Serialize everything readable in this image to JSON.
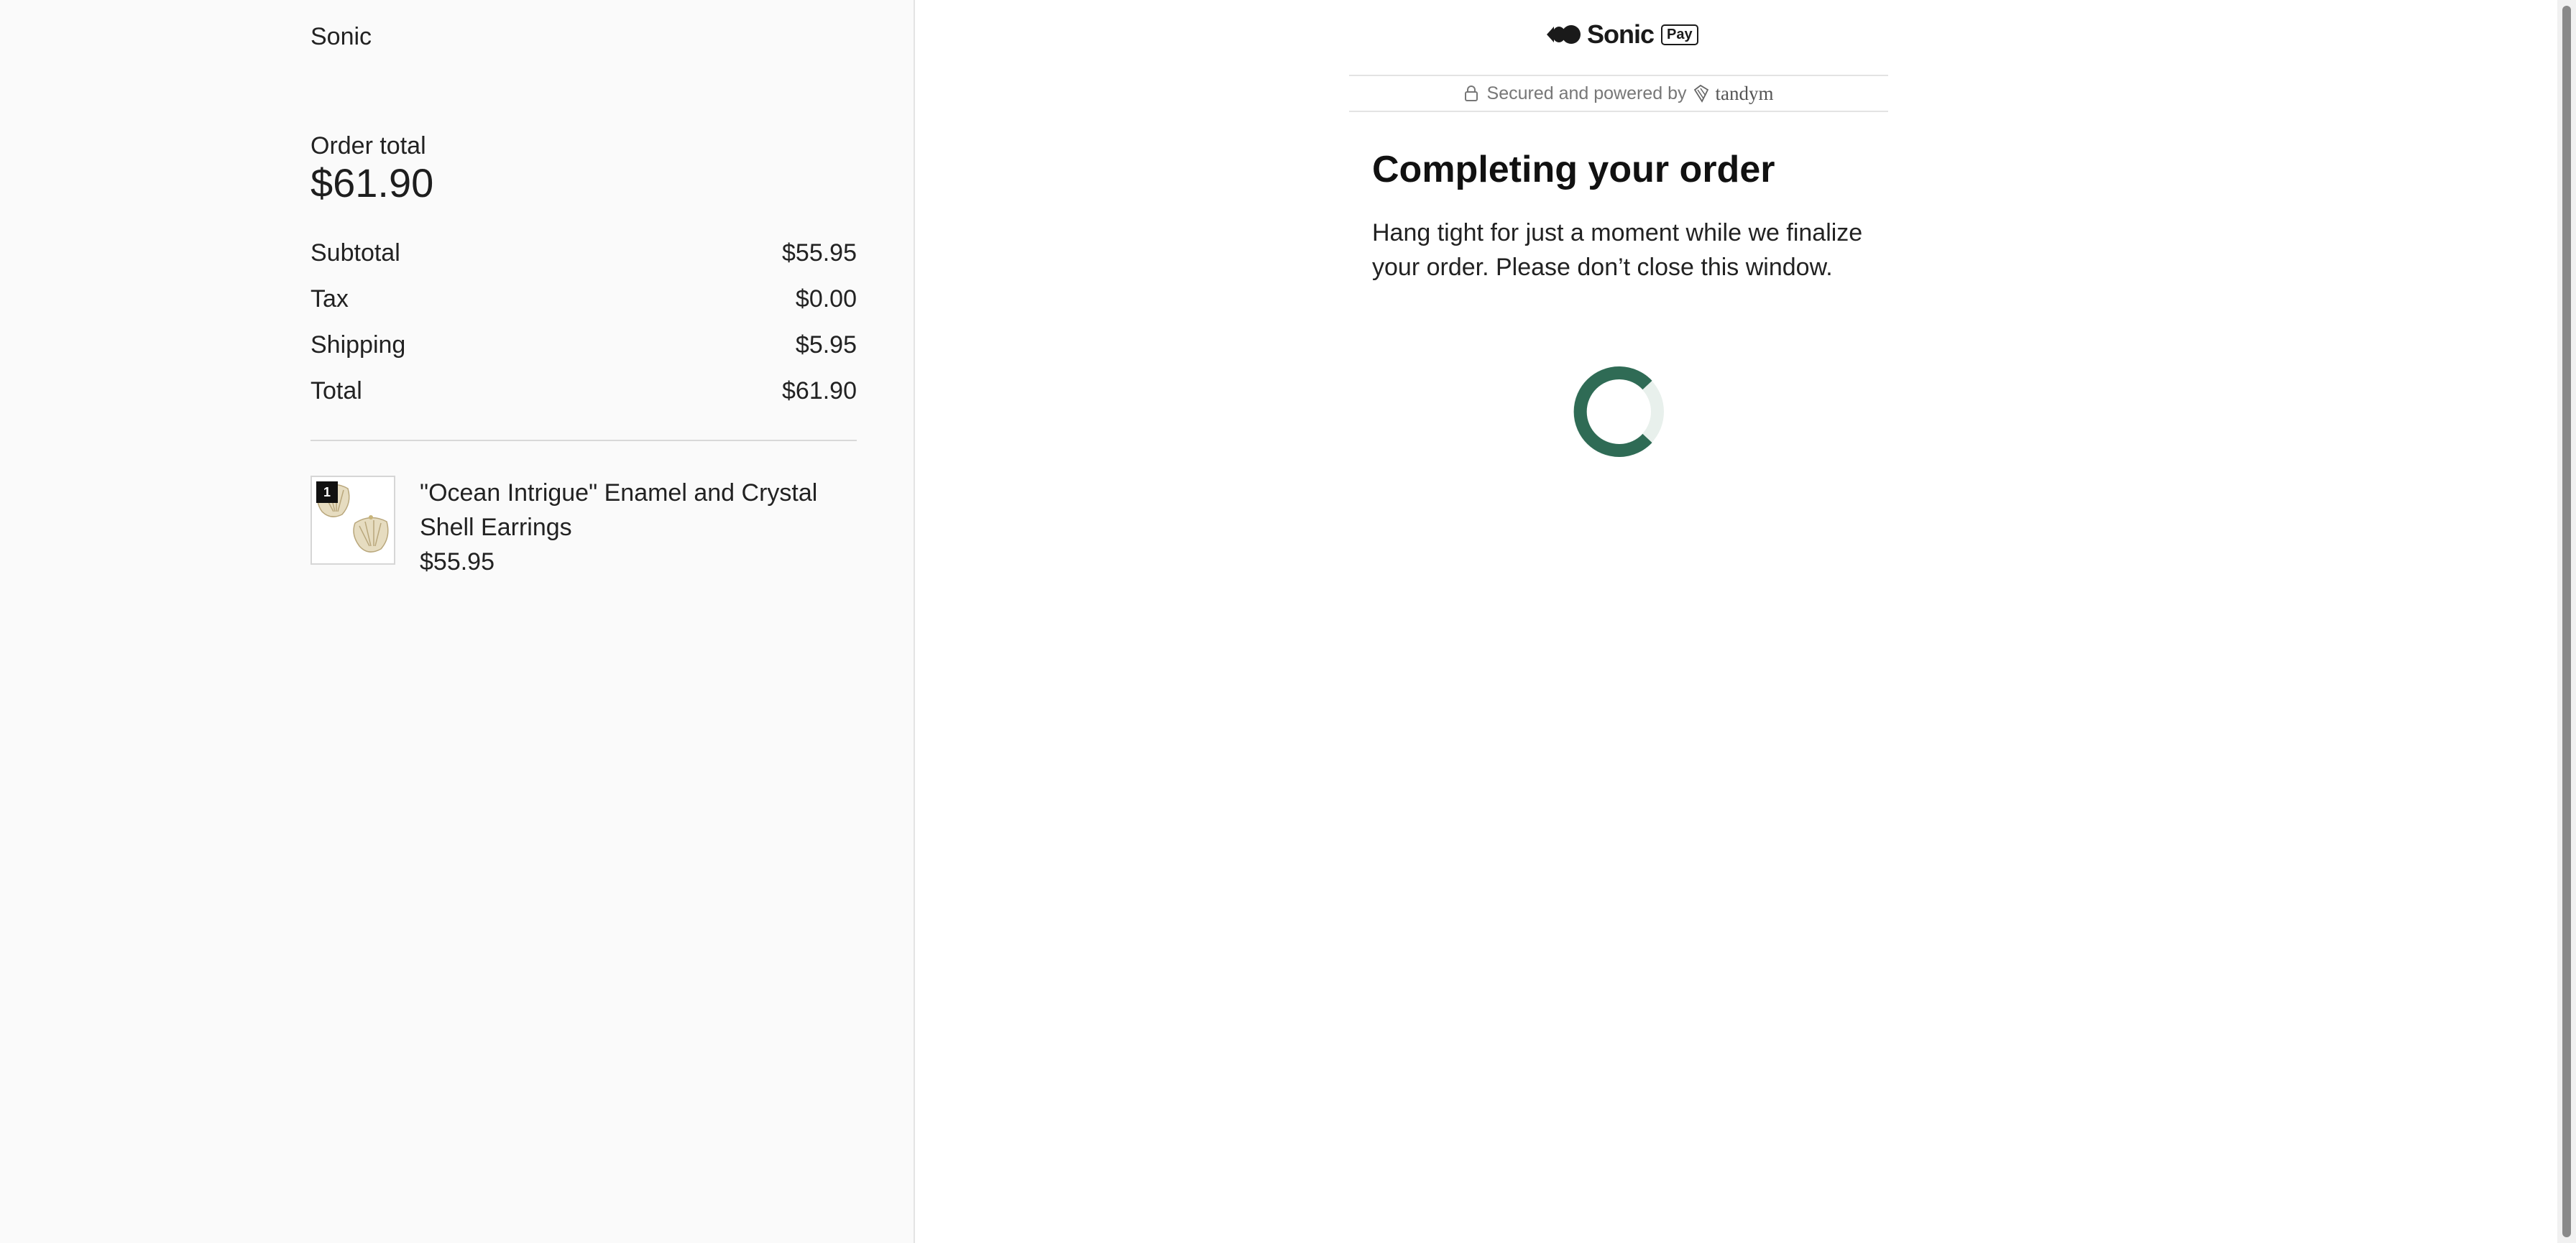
{
  "summary": {
    "store_name": "Sonic",
    "order_total_label": "Order total",
    "order_total_value": "$61.90",
    "lines": [
      {
        "label": "Subtotal",
        "value": "$55.95"
      },
      {
        "label": "Tax",
        "value": "$0.00"
      },
      {
        "label": "Shipping",
        "value": "$5.95"
      },
      {
        "label": "Total",
        "value": "$61.90"
      }
    ],
    "product": {
      "quantity": "1",
      "name": "\"Ocean Intrigue\" Enamel and Crystal Shell Earrings",
      "price": "$55.95",
      "image_icon": "shell-earrings-thumbnail"
    }
  },
  "checkout": {
    "brand_name": "Sonic",
    "pay_badge": "Pay",
    "secured_text": "Secured and powered by",
    "partner_name": "tandym",
    "heading": "Completing your order",
    "message": "Hang tight for just a moment while we finalize your order. Please don’t close this window.",
    "spinner_color": "#2f6b55",
    "spinner_track_color": "#e8f0ec"
  }
}
